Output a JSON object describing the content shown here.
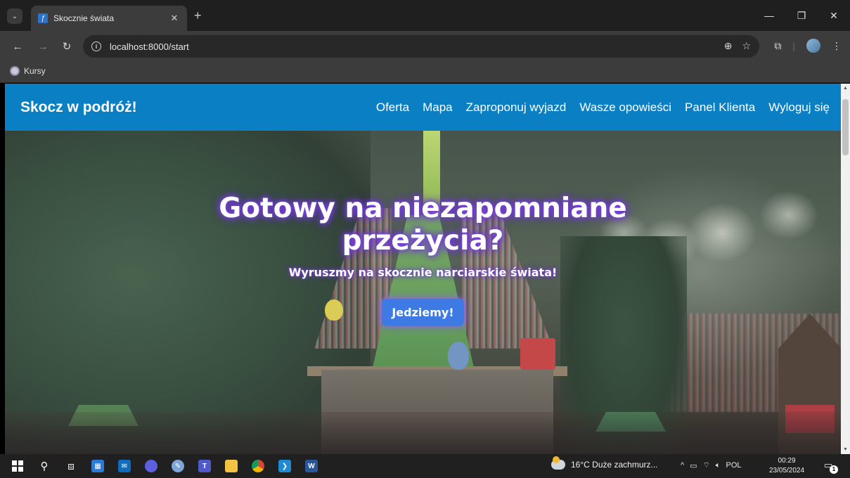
{
  "browser": {
    "tab": {
      "title": "Skocznie świata",
      "favicon": "ski-jump-favicon-icon"
    },
    "url": "localhost:8000/start",
    "bookmarks": [
      {
        "label": "Kursy"
      }
    ]
  },
  "site": {
    "brand": "Skocz w podróż!",
    "nav": [
      "Oferta",
      "Mapa",
      "Zaproponuj wyjazd",
      "Wasze opowieści",
      "Panel Klienta",
      "Wyloguj się"
    ],
    "accent": "#0a7fc4"
  },
  "hero": {
    "title": "Gotowy na niezapomniane przeżycia?",
    "subtitle": "Wyruszmy na skocznie narciarskie świata!",
    "button": "Jedziemy!",
    "button_color": "#3d7ae3"
  },
  "taskbar": {
    "weather": "16°C  Duże zachmurz...",
    "language": "POL",
    "time": "00:29",
    "date": "23/05/2024",
    "notifications": "1"
  }
}
